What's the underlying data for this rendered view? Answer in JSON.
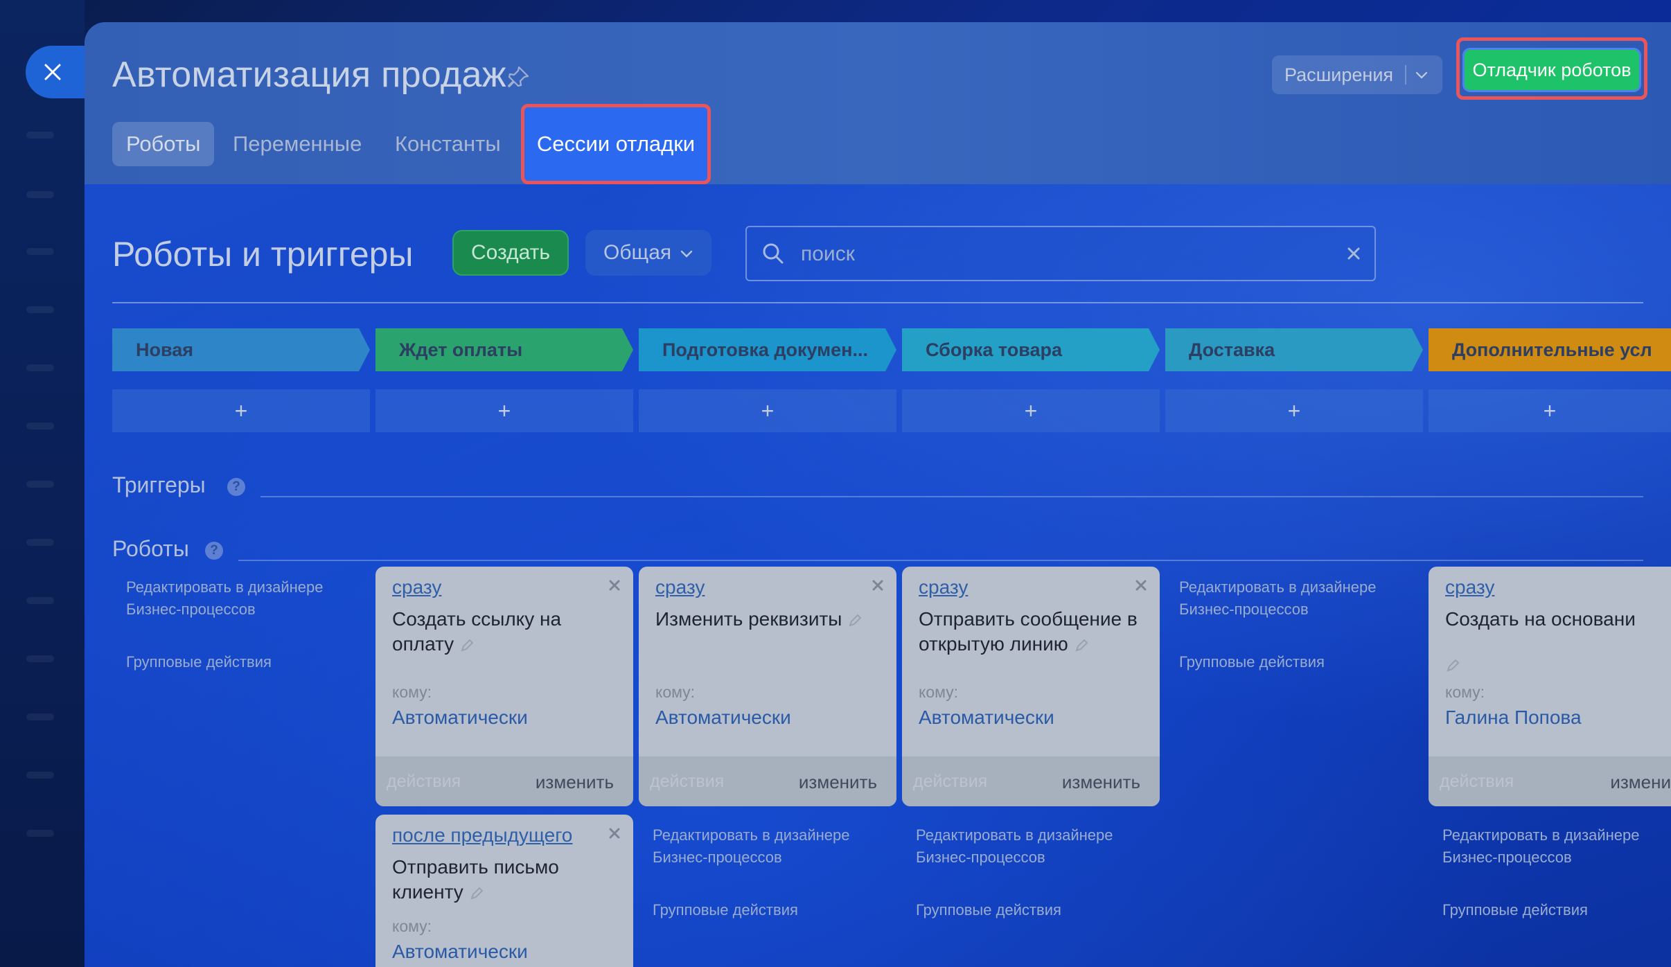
{
  "header": {
    "title": "Автоматизация продаж",
    "extensions_label": "Расширения",
    "debugger_label": "Отладчик роботов"
  },
  "tabs": [
    {
      "label": "Роботы"
    },
    {
      "label": "Переменные"
    },
    {
      "label": "Константы"
    },
    {
      "label": "Сессии отладки"
    }
  ],
  "main": {
    "title": "Роботы и триггеры",
    "create_label": "Создать",
    "general_label": "Общая",
    "search_placeholder": "поиск"
  },
  "stages": [
    {
      "label": "Новая",
      "color": "#2e86c8"
    },
    {
      "label": "Ждет оплаты",
      "color": "#2ba36e"
    },
    {
      "label": "Подготовка докумен...",
      "color": "#1c94cc"
    },
    {
      "label": "Сборка товара",
      "color": "#24a0c6"
    },
    {
      "label": "Доставка",
      "color": "#2a9ac2"
    },
    {
      "label": "Дополнительные усл",
      "color": "#cf8b12"
    }
  ],
  "add_symbol": "+",
  "sections": {
    "triggers": "Триггеры",
    "robots": "Роботы",
    "help": "?"
  },
  "links": {
    "edit_designer": "Редактировать в дизайнере Бизнес-процессов",
    "group_actions": "Групповые действия"
  },
  "cards": [
    {
      "when": "сразу",
      "name": "Создать ссылку на оплату",
      "to_label": "кому:",
      "to_value": "Автоматически",
      "actions": "действия",
      "edit": "изменить"
    },
    {
      "when": "сразу",
      "name": "Изменить реквизиты",
      "to_label": "кому:",
      "to_value": "Автоматически",
      "actions": "действия",
      "edit": "изменить"
    },
    {
      "when": "сразу",
      "name": "Отправить сообщение в открытую линию",
      "to_label": "кому:",
      "to_value": "Автоматически",
      "actions": "действия",
      "edit": "изменить"
    },
    {
      "when": "сразу",
      "name": "Создать на основани",
      "to_label": "кому:",
      "to_value": "Галина Попова",
      "actions": "действия",
      "edit": "измени"
    },
    {
      "when": "после предыдущего",
      "name": "Отправить письмо клиенту",
      "to_label": "кому:",
      "to_value": "Автоматически"
    }
  ],
  "icons": {
    "close": "close-icon",
    "pin": "pin-icon",
    "chevron": "chevron-down-icon",
    "search": "search-icon",
    "clear": "clear-icon",
    "pencil": "pencil-icon"
  },
  "colors": {
    "debugger_button": "#1ec269",
    "highlight_frame": "#e9555a",
    "active_tab": "#2a69f0",
    "create_button": "#1a8a4e"
  }
}
